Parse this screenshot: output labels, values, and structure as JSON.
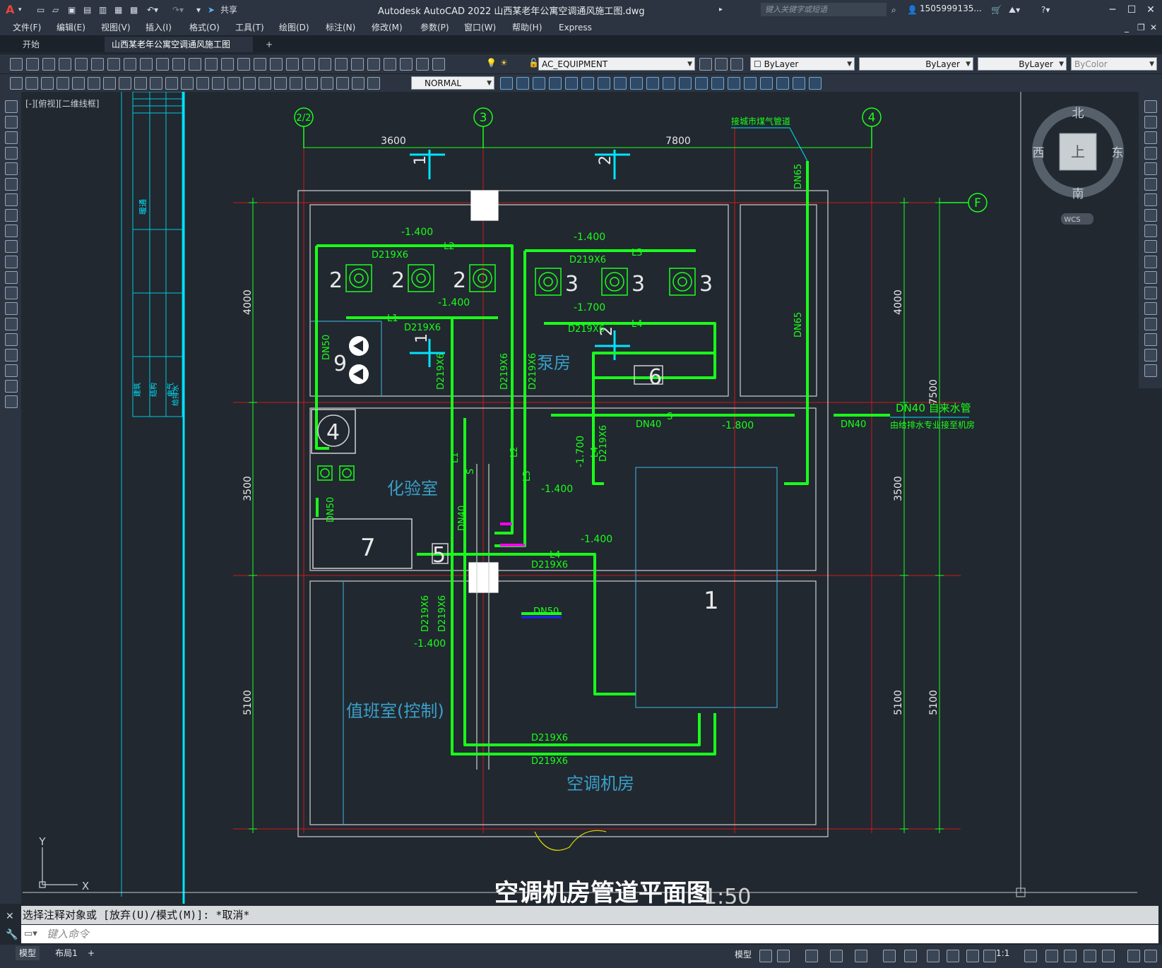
{
  "titlebar": {
    "app_title": "Autodesk AutoCAD 2022    山西某老年公寓空调通风施工图.dwg",
    "share_label": "共享",
    "search_placeholder": "键入关键字或短语",
    "user": "1505999135..."
  },
  "menu": [
    "文件(F)",
    "编辑(E)",
    "视图(V)",
    "插入(I)",
    "格式(O)",
    "工具(T)",
    "绘图(D)",
    "标注(N)",
    "修改(M)",
    "参数(P)",
    "窗口(W)",
    "帮助(H)",
    "Express"
  ],
  "tabs": {
    "start": "开始",
    "active": "山西某老年公寓空调通风施工图*"
  },
  "properties": {
    "layer": "AC_EQUIPMENT",
    "color": "ByLayer",
    "linetype": "ByLayer",
    "lineweight": "ByLayer",
    "plotstyle": "ByColor",
    "dimstyle": "NORMAL"
  },
  "viewport": {
    "label": "[-][俯视][二维线框]"
  },
  "viewcube": {
    "north": "北",
    "south": "南",
    "east": "东",
    "west": "西",
    "top": "上",
    "wcs": "WCS"
  },
  "ucs": {
    "x": "X",
    "y": "Y"
  },
  "drawing": {
    "title": "空调机房管道平面图",
    "scale": "1:50",
    "axis_labels": {
      "a1": "2/2",
      "a2": "3",
      "a3": "4",
      "aF": "F"
    },
    "top_dims": [
      "3600",
      "7800"
    ],
    "left_dims": [
      "4000",
      "3500",
      "5100"
    ],
    "right_dims_inner": [
      "4000",
      "3500",
      "5100"
    ],
    "right_dims_outer": [
      "7500",
      "5100"
    ],
    "rooms": {
      "pump": "泵房",
      "lab": "化验室",
      "duty": "值班室(控制)",
      "ac": "空调机房"
    },
    "gas_note": "接城市煤气管道",
    "water_note1": "DN40 自来水管",
    "water_note2": "由给排水专业接至机房",
    "pipe_labels": {
      "dn65_a": "DN65",
      "dn65_b": "DN65",
      "dn40_a": "DN40",
      "dn40_b": "DN40",
      "dn40_c": "DN40",
      "dn50_a": "DN50",
      "dn50_b": "DN50",
      "dn50_c": "DN50",
      "d1": "D219X6",
      "d2": "D219X6",
      "d3": "D219X6",
      "d4": "D219X6",
      "d5": "D219X6",
      "d6": "D219X6",
      "d7": "D219X6",
      "d8": "D219X6",
      "d9": "D219X6",
      "d10": "D219X6",
      "d11": "D219X6",
      "l1": "L1",
      "l1b": "L1",
      "l2": "L2",
      "l2b": "L2",
      "l3": "L3",
      "l3b": "L3",
      "l4": "L4",
      "l4b": "L4",
      "l4c": "L4",
      "s1": "S",
      "s2": "S"
    },
    "elevations": {
      "e1": "-1.400",
      "e2": "-1.400",
      "e3": "-1.400",
      "e4": "-1.700",
      "e5": "-1.800",
      "e6": "-1.700",
      "e7": "-1.400",
      "e8": "-1.400",
      "e9": "-1.400"
    },
    "equipment": {
      "eq1": "1",
      "eq2": "2",
      "eq3": "3",
      "eq4": "4",
      "eq5": "5",
      "eq6": "6",
      "eq7": "7",
      "eq9": "9"
    },
    "section_marks": {
      "s1": "1",
      "s2": "2"
    },
    "legend_table_text": [
      "暖通",
      "建筑",
      "结构",
      "电气",
      "给排水"
    ]
  },
  "command": {
    "history": "选择注释对象或 [放弃(U)/模式(M)]: *取消*",
    "input_placeholder": "键入命令"
  },
  "layouts": [
    "模型",
    "布局1"
  ],
  "status": {
    "model": "模型",
    "scale": "1:1"
  },
  "colors": {
    "pipe_green": "#1aff1a",
    "axis_red": "#d01818",
    "cyan": "#00e5ff",
    "room_text": "#3aa0c8",
    "wall": "#d0d0d0",
    "background": "#212830"
  }
}
